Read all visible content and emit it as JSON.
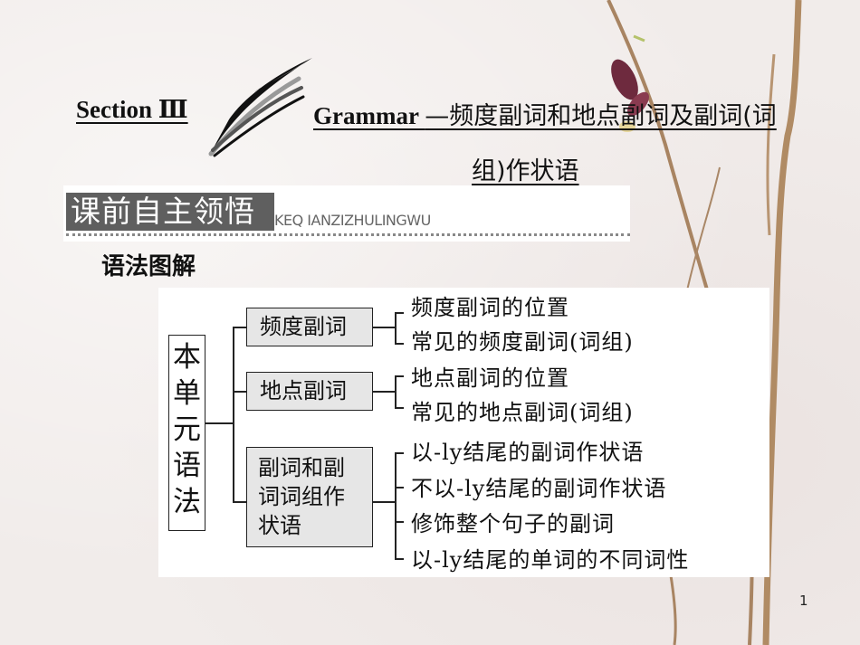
{
  "slide": {
    "title": {
      "section_label": "Section Ⅲ",
      "grammar_label": "Grammar ",
      "topic_line1": "—频度副词和地点副词及副词(词",
      "topic_line2": "组)作状语"
    },
    "banner": {
      "heading": "课前自主领悟",
      "pinyin": "KEQ IANZIZHULINGWU"
    },
    "subheading": "语法图解",
    "diagram": {
      "root": [
        "本",
        "单",
        "元",
        "语",
        "法"
      ],
      "categories": [
        {
          "label": "频度副词",
          "items": [
            "频度副词的位置",
            "常见的频度副词(词组)"
          ]
        },
        {
          "label": "地点副词",
          "items": [
            "地点副词的位置",
            "常见的地点副词(词组)"
          ]
        },
        {
          "label_lines": [
            "副词和副",
            "词词组作",
            "状语"
          ],
          "items": [
            "以-ly结尾的副词作状语",
            "不以-ly结尾的副词作状语",
            "修饰整个句子的副词",
            "以-ly结尾的单词的不同词性"
          ]
        }
      ]
    },
    "page_number": "1"
  }
}
